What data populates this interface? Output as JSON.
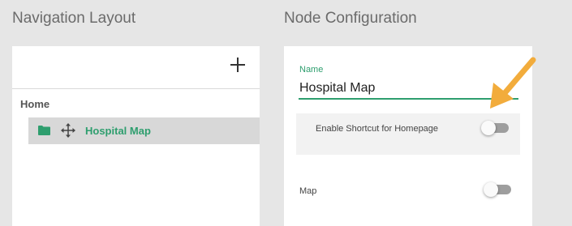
{
  "left": {
    "title": "Navigation Layout",
    "home_label": "Home",
    "tree": [
      {
        "label": "Hospital Map",
        "icon": "folder-icon",
        "drag_icon": "move-icon"
      }
    ]
  },
  "right": {
    "title": "Node Configuration",
    "name_label": "Name",
    "name_value": "Hospital Map",
    "shortcut_label": "Enable Shortcut for Homepage",
    "shortcut_enabled": false,
    "map_label": "Map",
    "map_enabled": false
  },
  "colors": {
    "accent": "#2e9e6e",
    "annotation_arrow": "#f2ac3c",
    "background": "#e6e6e6"
  }
}
